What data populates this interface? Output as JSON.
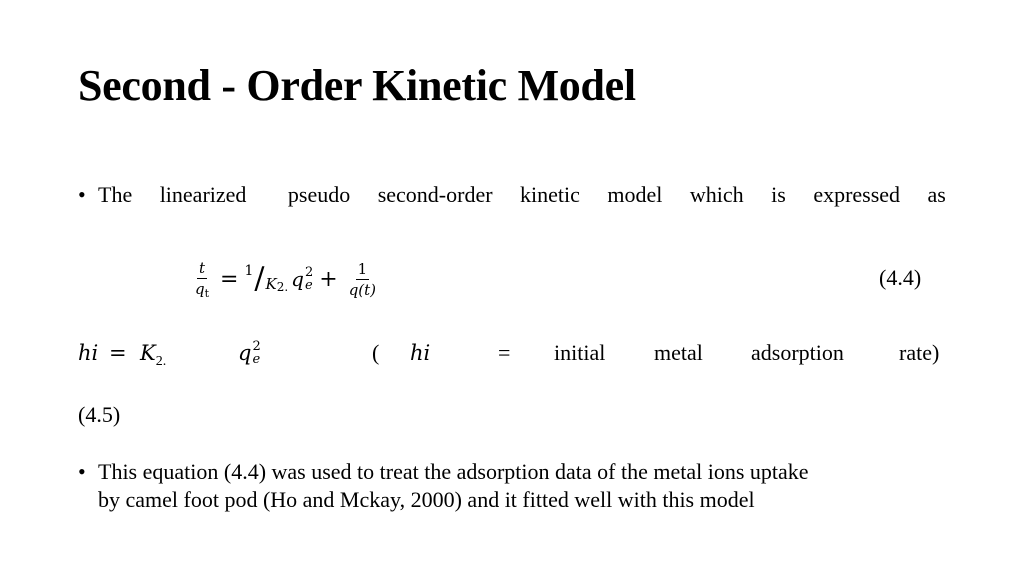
{
  "slide": {
    "title": "Second - Order Kinetic Model",
    "bullet_symbol": "•",
    "bullet1": {
      "words": [
        "The",
        "linearized",
        "pseudo",
        "second-order",
        "kinetic",
        "model",
        "which",
        "is",
        "expressed",
        "as"
      ]
    },
    "equation_4_4": {
      "lhs_numerator": "t",
      "lhs_denominator_base": "q",
      "lhs_denominator_sub": "t",
      "equals": "=",
      "slash_numerator": "1",
      "slash": "/",
      "slash_denominator": "K",
      "slash_denominator_sub": "2.",
      "q_base": "q",
      "q_sup": "2",
      "q_sub": "e",
      "plus": "+",
      "rhs_numerator": "1",
      "rhs_denominator": "q(t)",
      "label": "(4.4)"
    },
    "equation_4_5": {
      "lhs": "hi",
      "equals": "=",
      "k_base": "K",
      "k_sub": "2.",
      "q_base": "q",
      "q_sup": "2",
      "q_sub": "e",
      "open_paren": "(",
      "hi_word": "hi",
      "def_equals": "=",
      "def_words": [
        "initial",
        "metal",
        "adsorption",
        "rate)"
      ],
      "label": "(4.5)"
    },
    "bullet2": {
      "line1": "This equation (4.4) was used to treat the adsorption data of the metal ions uptake",
      "line2": "by camel foot pod (Ho and Mckay, 2000) and it fitted well with this model"
    }
  }
}
